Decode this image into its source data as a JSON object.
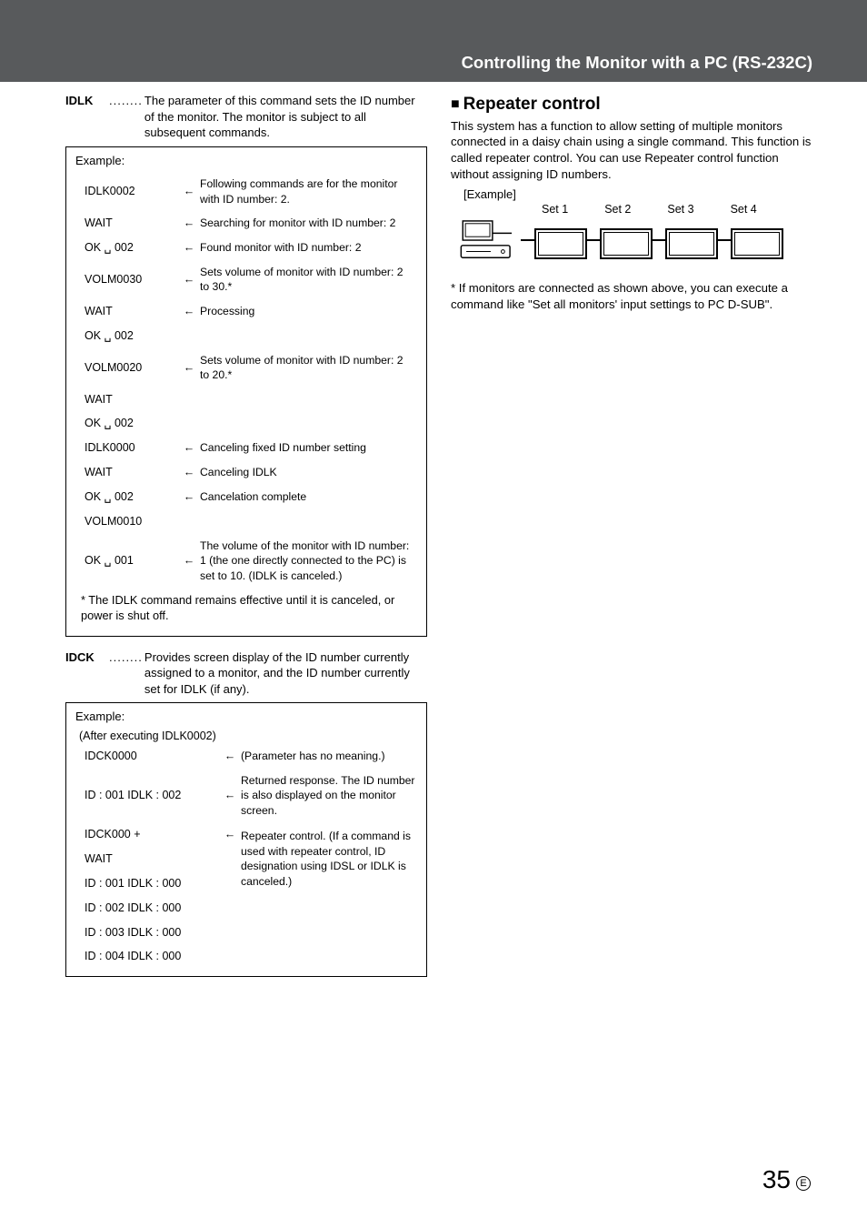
{
  "header": {
    "title": "Controlling the Monitor with a PC (RS-232C)"
  },
  "left": {
    "idlk": {
      "name": "IDLK",
      "dots": "........",
      "desc": "The parameter of this command sets the ID number of the monitor. The monitor is subject to all subsequent commands."
    },
    "ex1": {
      "label": "Example:",
      "rows": [
        {
          "c1": "IDLK0002",
          "arr": "←",
          "desc": "Following commands are for the monitor with ID number: 2."
        },
        {
          "c1": "WAIT",
          "arr": "←",
          "desc": "Searching for monitor with ID number: 2"
        },
        {
          "c1": "OK ␣ 002",
          "arr": "←",
          "desc": "Found monitor with ID number: 2"
        },
        {
          "c1": "VOLM0030",
          "arr": "←",
          "desc": "Sets volume of monitor with ID number: 2 to 30.*"
        },
        {
          "c1": "WAIT",
          "arr": "←",
          "desc": "Processing"
        },
        {
          "c1": "OK ␣ 002",
          "arr": "",
          "desc": ""
        },
        {
          "c1": "VOLM0020",
          "arr": "←",
          "desc": "Sets volume of monitor with ID number: 2 to 20.*"
        },
        {
          "c1": "WAIT",
          "arr": "",
          "desc": ""
        },
        {
          "c1": "OK ␣ 002",
          "arr": "",
          "desc": ""
        },
        {
          "c1": "IDLK0000",
          "arr": "←",
          "desc": "Canceling fixed ID number setting"
        },
        {
          "c1": "WAIT",
          "arr": "←",
          "desc": "Canceling IDLK"
        },
        {
          "c1": "OK ␣ 002",
          "arr": "←",
          "desc": "Cancelation complete"
        },
        {
          "c1": "VOLM0010",
          "arr": "",
          "desc": ""
        },
        {
          "c1": "OK ␣ 001",
          "arr": "←",
          "desc": "The volume of the monitor with ID number: 1 (the one directly connected to the PC) is set to 10. (IDLK is canceled.)"
        }
      ],
      "note": "*  The IDLK command remains effective until it is canceled, or power is shut off."
    },
    "idck": {
      "name": "IDCK",
      "dots": "........",
      "desc": "Provides screen display of the ID number currently assigned to a monitor, and the ID number currently set for IDLK (if any)."
    },
    "ex2": {
      "label": "Example:",
      "after": "(After executing IDLK0002)",
      "rows": [
        {
          "c1": "IDCK0000",
          "arr": "←",
          "desc": "(Parameter has no meaning.)"
        },
        {
          "c1": "ID : 001   IDLK : 002",
          "arr": "←",
          "desc": "Returned response. The ID number is also displayed on the monitor screen."
        },
        {
          "c1": "IDCK000 +",
          "arr": "←",
          "desc": "Repeater control. (If a command is used with repeater control, ID designation using IDSL or IDLK is canceled.)"
        },
        {
          "c1": "WAIT",
          "arr": "",
          "desc": ""
        },
        {
          "c1": "ID : 001   IDLK : 000",
          "arr": "",
          "desc": ""
        },
        {
          "c1": "ID : 002   IDLK : 000",
          "arr": "",
          "desc": ""
        },
        {
          "c1": "ID : 003   IDLK : 000",
          "arr": "",
          "desc": ""
        },
        {
          "c1": "ID : 004   IDLK : 000",
          "arr": "",
          "desc": ""
        }
      ]
    }
  },
  "right": {
    "heading": "Repeater control",
    "para": "This system has a function to allow setting of multiple monitors connected in a daisy chain using a single command. This function is called repeater control. You can use Repeater control function without assigning ID numbers.",
    "ex_label": "[Example]",
    "sets": [
      "Set 1",
      "Set 2",
      "Set 3",
      "Set 4"
    ],
    "footnote": "*  If monitors are connected as shown above, you can execute a command like \"Set all monitors' input settings to PC D-SUB\"."
  },
  "page": {
    "num": "35",
    "e": "E"
  }
}
